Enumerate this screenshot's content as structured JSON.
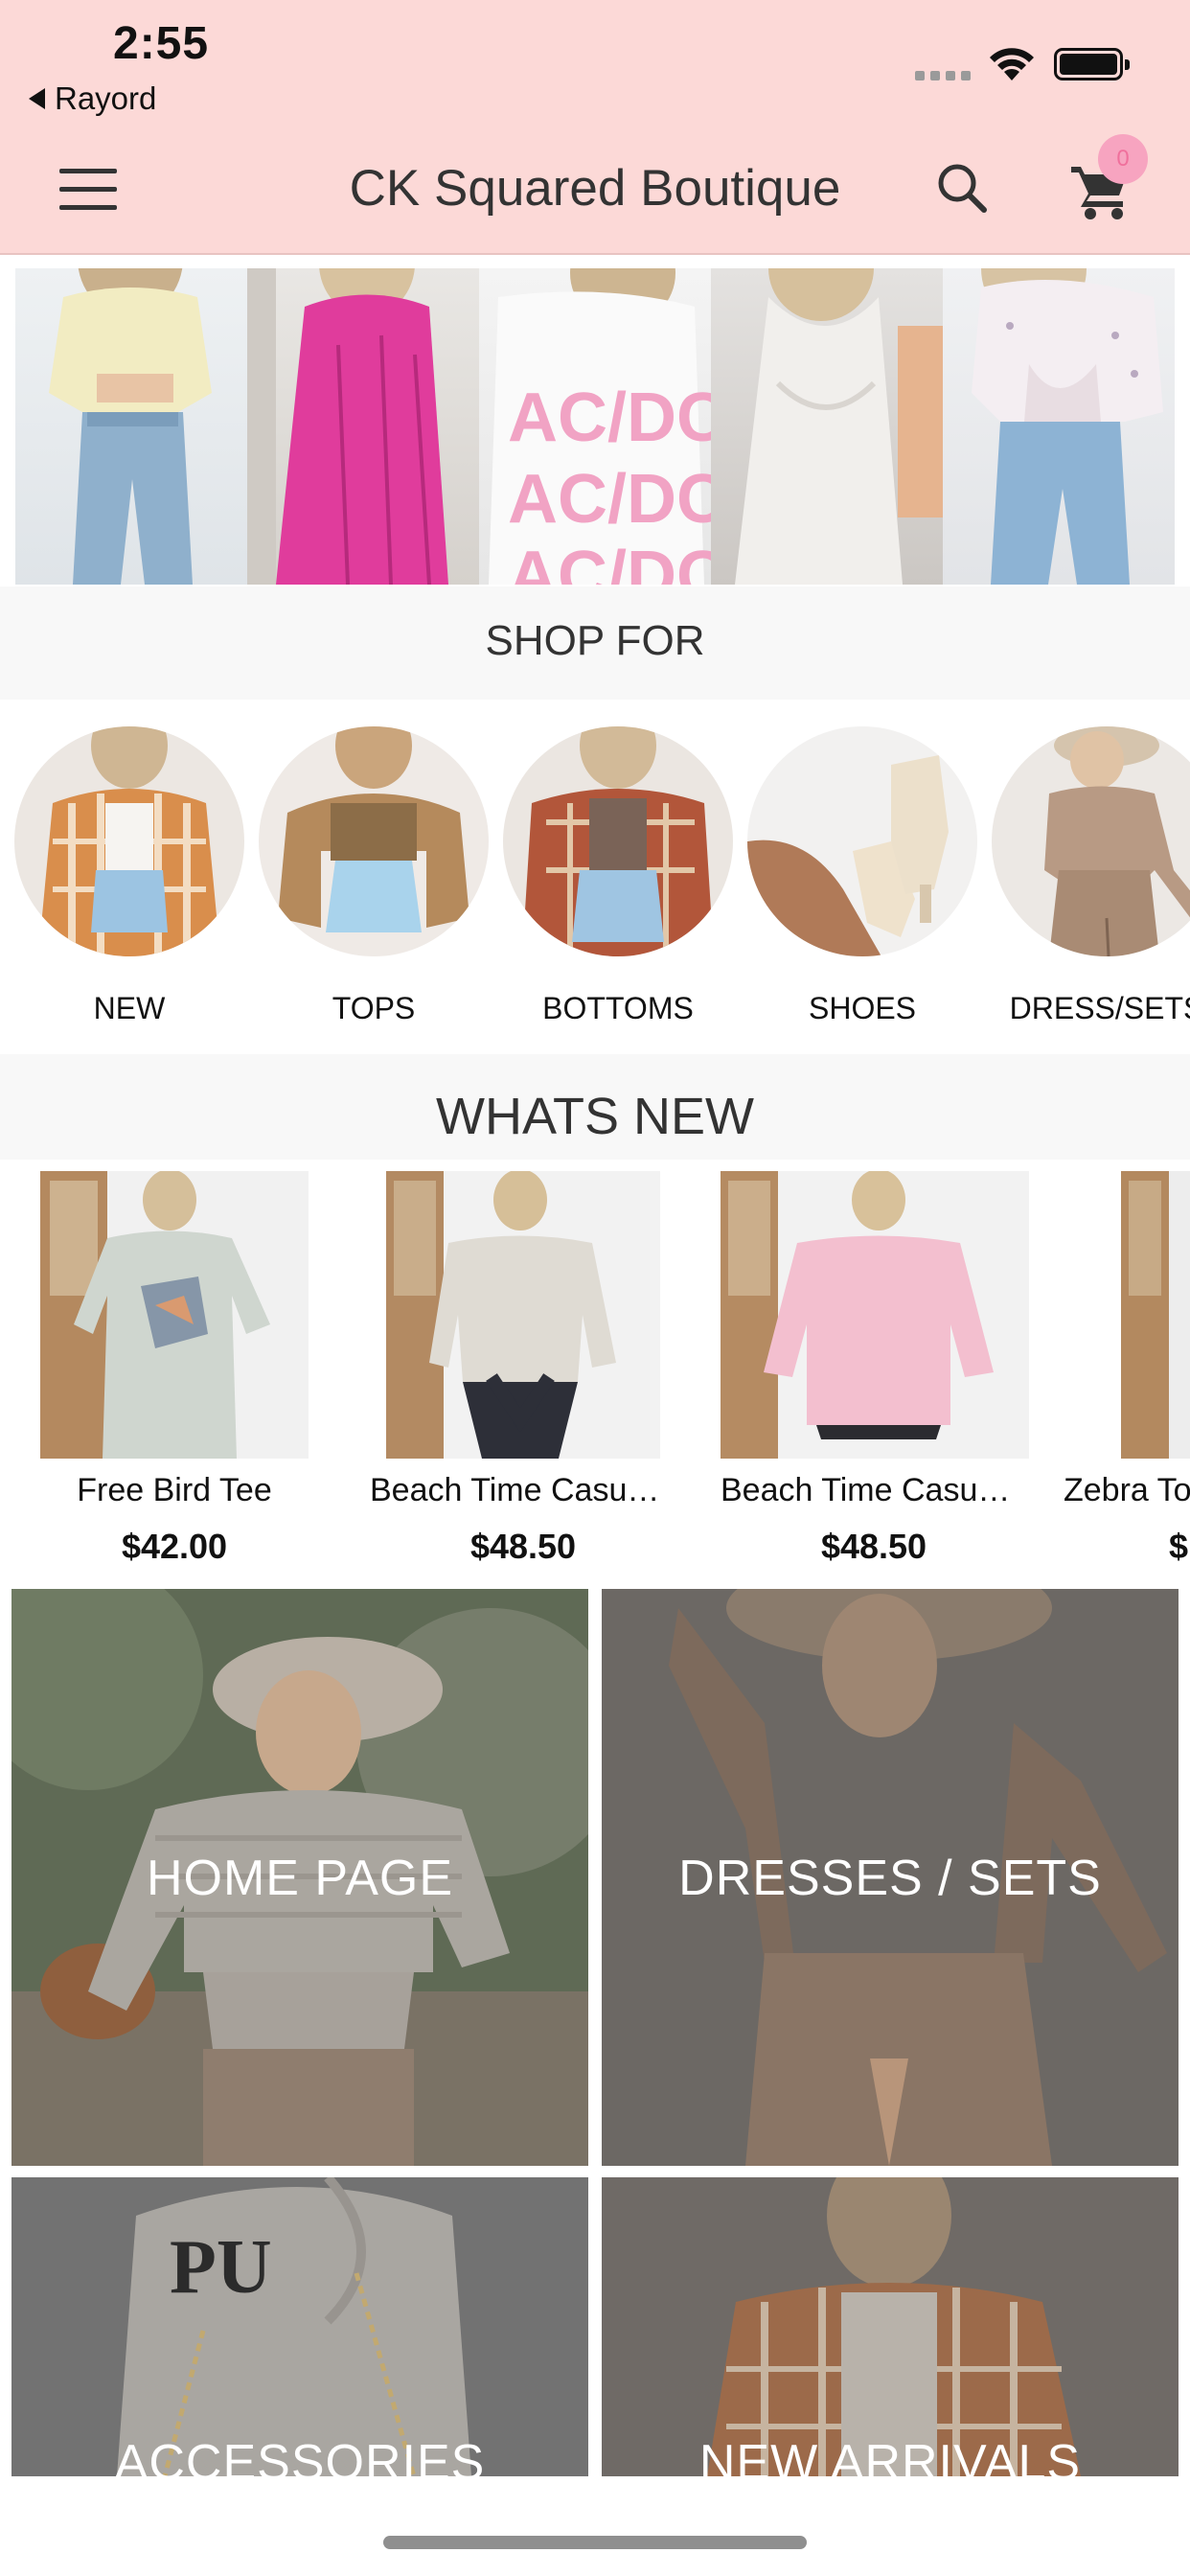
{
  "status_bar": {
    "time": "2:55",
    "back_app": "Rayord"
  },
  "header": {
    "title": "CK Squared Boutique",
    "menu_icon": "hamburger-menu-icon",
    "search_icon": "search-icon",
    "cart_icon": "shopping-cart-icon",
    "cart_count": "0",
    "background_color": "#fcd9d7",
    "badge_color": "#f7a4c0"
  },
  "shop_for": {
    "title": "SHOP FOR",
    "categories": [
      {
        "label": "NEW"
      },
      {
        "label": "TOPS"
      },
      {
        "label": "BOTTOMS"
      },
      {
        "label": "SHOES"
      },
      {
        "label": "DRESS/SETS"
      }
    ]
  },
  "whats_new": {
    "title": "WHATS NEW",
    "products": [
      {
        "name": "Free Bird Tee",
        "price": "$42.00"
      },
      {
        "name": "Beach Time Casual Top",
        "price": "$48.50"
      },
      {
        "name": "Beach Time Casual Top",
        "price": "$48.50"
      },
      {
        "name": "Zebra Top",
        "price": "$"
      }
    ]
  },
  "category_grid": [
    {
      "label": "HOME PAGE"
    },
    {
      "label": "DRESSES / SETS"
    },
    {
      "label": "ACCESSORIES"
    },
    {
      "label": "NEW ARRIVALS"
    }
  ]
}
